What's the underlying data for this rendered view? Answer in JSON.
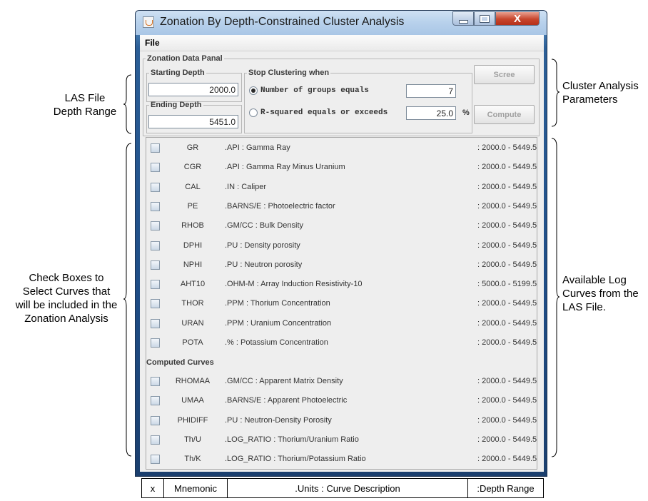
{
  "annotations": {
    "las_range": [
      "LAS File",
      "Depth Range"
    ],
    "cluster_params": [
      "Cluster Analysis",
      "Parameters"
    ],
    "check_boxes": [
      "Check Boxes to",
      "Select Curves that",
      "will be included in the",
      "Zonation Analysis"
    ],
    "available_curves": [
      "Available Log",
      "Curves from the",
      "LAS File."
    ]
  },
  "window": {
    "title": "Zonation By Depth-Constrained Cluster Analysis",
    "close_glyph": "X"
  },
  "menu": {
    "file": "File"
  },
  "panel": {
    "title": "Zonation Data Panal",
    "starting_depth": {
      "label": "Starting Depth",
      "value": "2000.0"
    },
    "ending_depth": {
      "label": "Ending Depth",
      "value": "5451.0"
    },
    "stop_clustering": {
      "label": "Stop Clustering when",
      "option_groups": "Number of groups equals",
      "groups_value": "7",
      "option_rsq": "R-squared equals or exceeds",
      "rsq_value": "25.0",
      "rsq_unit": "%"
    },
    "scree_button": "Scree",
    "compute_button": "Compute"
  },
  "curves": [
    {
      "mnemonic": "GR",
      "desc": ".API : Gamma Ray",
      "range": ": 2000.0 - 5449.5"
    },
    {
      "mnemonic": "CGR",
      "desc": ".API : Gamma Ray Minus Uranium",
      "range": ": 2000.0 - 5449.5"
    },
    {
      "mnemonic": "CAL",
      "desc": ".IN : Caliper",
      "range": ": 2000.0 - 5449.5"
    },
    {
      "mnemonic": "PE",
      "desc": ".BARNS/E : Photoelectric factor",
      "range": ": 2000.0 - 5449.5"
    },
    {
      "mnemonic": "RHOB",
      "desc": ".GM/CC : Bulk Density",
      "range": ": 2000.0 - 5449.5"
    },
    {
      "mnemonic": "DPHI",
      "desc": ".PU : Density porosity",
      "range": ": 2000.0 - 5449.5"
    },
    {
      "mnemonic": "NPHI",
      "desc": ".PU : Neutron porosity",
      "range": ": 2000.0 - 5449.5"
    },
    {
      "mnemonic": "AHT10",
      "desc": ".OHM-M : Array Induction Resistivity-10",
      "range": ": 5000.0 - 5199.5"
    },
    {
      "mnemonic": "THOR",
      "desc": ".PPM : Thorium Concentration",
      "range": ": 2000.0 - 5449.5"
    },
    {
      "mnemonic": "URAN",
      "desc": ".PPM : Uranium Concentration",
      "range": ": 2000.0 - 5449.5"
    },
    {
      "mnemonic": "POTA",
      "desc": ".% : Potassium Concentration",
      "range": ": 2000.0 - 5449.5"
    }
  ],
  "computed_header": "Computed Curves",
  "computed_curves": [
    {
      "mnemonic": "RHOMAA",
      "desc": ".GM/CC : Apparent Matrix Density",
      "range": ": 2000.0 - 5449.5"
    },
    {
      "mnemonic": "UMAA",
      "desc": ".BARNS/E : Apparent Photoelectric",
      "range": ": 2000.0 - 5449.5"
    },
    {
      "mnemonic": "PHIDIFF",
      "desc": ".PU : Neutron-Density Porosity",
      "range": ": 2000.0 - 5449.5"
    },
    {
      "mnemonic": "Th/U",
      "desc": ".LOG_RATIO : Thorium/Uranium Ratio",
      "range": ": 2000.0 - 5449.5"
    },
    {
      "mnemonic": "Th/K",
      "desc": ".LOG_RATIO : Thorium/Potassium Ratio",
      "range": ": 2000.0 - 5449.5"
    }
  ],
  "legend_table": {
    "x": "x",
    "mnemonic": "Mnemonic",
    "units_desc": ".Units : Curve  Description",
    "depth_range": ":Depth Range"
  }
}
